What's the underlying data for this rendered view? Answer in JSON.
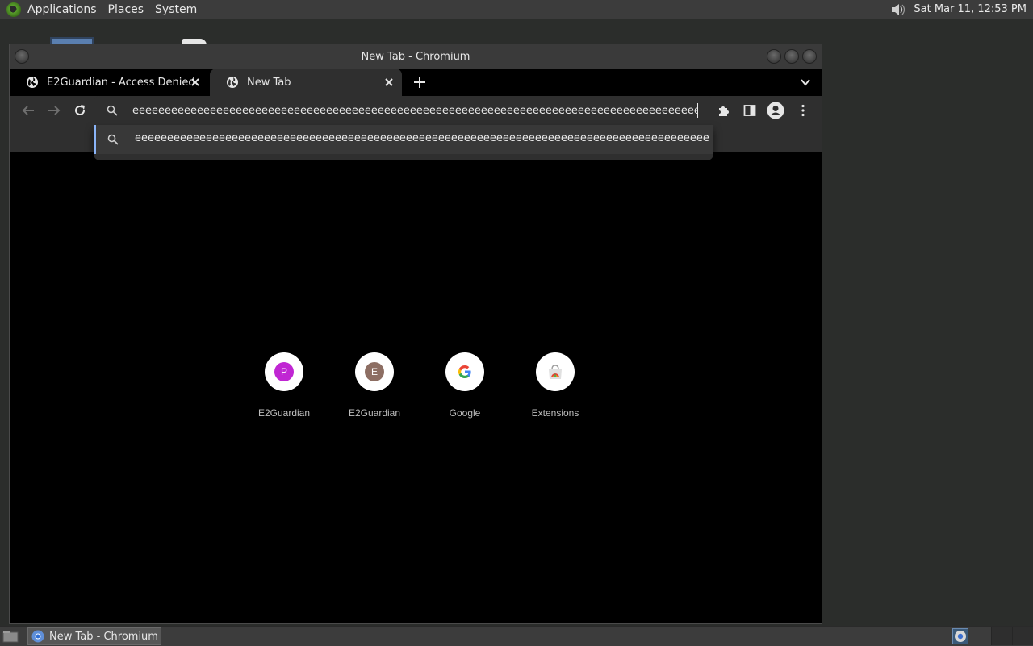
{
  "top_panel": {
    "menus": [
      "Applications",
      "Places",
      "System"
    ],
    "clock": "Sat Mar 11, 12:53 PM"
  },
  "window": {
    "title": "New Tab - Chromium"
  },
  "tabs": [
    {
      "label": "E2Guardian - Access Denied",
      "active": false
    },
    {
      "label": "New Tab",
      "active": true
    }
  ],
  "omnibox": {
    "value": "eeeeeeeeeeeeeeeeeeeeeeeeeeeeeeeeeeeeeeeeeeeeeeeeeeeeeeeeeeeeeeeeeeeeeeeeeeeeeeeeeeeeeeeeeeee..."
  },
  "suggestion": {
    "text": "eeeeeeeeeeeeeeeeeeeeeeeeeeeeeeeeeeeeeeeeeeeeeeeeeeeeeeeeeeeeeeeeeeeeeeeeeeeeeeeeeeeeeeeeeeeeeeeeeeeeeeeeeeeee..."
  },
  "shortcuts": [
    {
      "title": "E2Guardian",
      "letter": "P",
      "badge_color": "#c026d3",
      "icon": "letter-badge"
    },
    {
      "title": "E2Guardian",
      "letter": "E",
      "badge_color": "#8d6e63",
      "icon": "letter-badge"
    },
    {
      "title": "Google",
      "icon": "google-icon"
    },
    {
      "title": "Extensions",
      "icon": "chrome-web-store-icon"
    }
  ],
  "taskbar": {
    "button_label": "New Tab - Chromium"
  },
  "colors": {
    "accent": "#8ab4f8",
    "panel": "#3c3c3c",
    "toolbar": "#2f2f2f"
  }
}
